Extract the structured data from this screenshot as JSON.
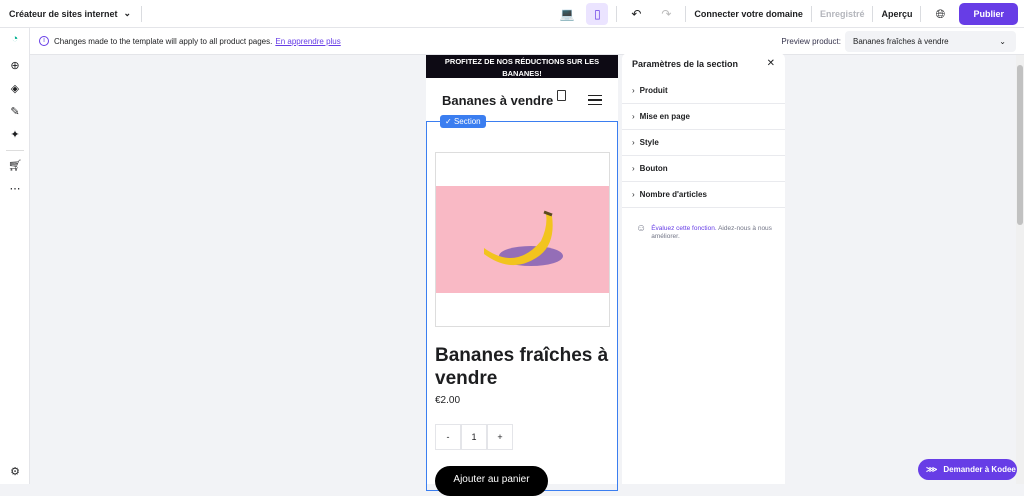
{
  "topbar": {
    "brand": "Créateur de sites internet",
    "connect": "Connecter votre domaine",
    "saved": "Enregistré",
    "preview": "Aperçu",
    "publish": "Publier"
  },
  "infobar": {
    "message": "Changes made to the template will apply to all product pages.",
    "link": "En apprendre plus",
    "preview_label": "Preview product:",
    "preview_value": "Bananes fraîches à vendre"
  },
  "store": {
    "promo": "PROFITEZ DE NOS RÉDUCTIONS SUR LES BANANES!",
    "title": "Bananes à vendre",
    "section_badge": "Section",
    "product_name": "Bananes fraîches à vendre",
    "price": "€2.00",
    "qty_minus": "-",
    "qty": "1",
    "qty_plus": "+",
    "add_to_cart": "Ajouter au panier"
  },
  "panel": {
    "title": "Paramètres de la section",
    "items": [
      "Produit",
      "Mise en page",
      "Style",
      "Bouton",
      "Nombre d'articles"
    ],
    "feedback_link": "Évaluez cette fonction.",
    "feedback_text": "Aidez-nous à nous améliorer."
  },
  "kodee": "Demander à Kodee",
  "colors": {
    "accent": "#673de6",
    "section": "#3b7ef0"
  }
}
